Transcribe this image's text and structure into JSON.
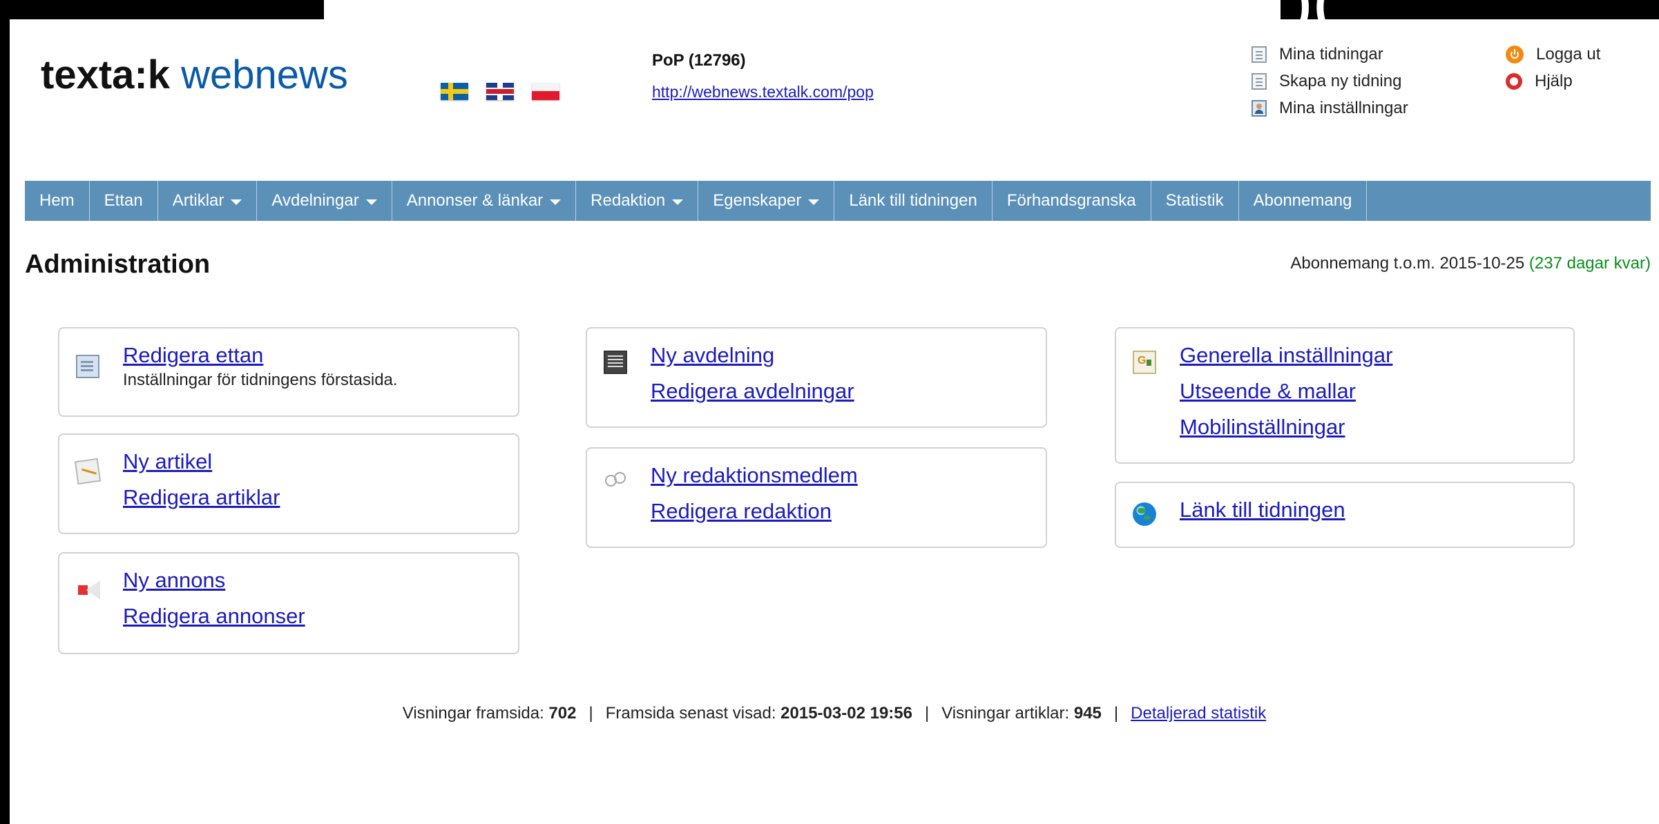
{
  "brand": {
    "logo_bold": "texta:k",
    "logo_light": " webnews"
  },
  "account": {
    "title": "PoP (12796)",
    "url": "http://webnews.textalk.com/pop"
  },
  "top_links": {
    "column_one": [
      {
        "label": "Mina tidningar",
        "icon": "document-icon"
      },
      {
        "label": "Skapa ny tidning",
        "icon": "document-icon"
      },
      {
        "label": "Mina inställningar",
        "icon": "user-settings-icon"
      }
    ],
    "column_two": [
      {
        "label": "Logga ut",
        "icon": "power-icon"
      },
      {
        "label": "Hjälp",
        "icon": "help-icon"
      }
    ]
  },
  "nav": {
    "items": [
      {
        "label": "Hem",
        "dropdown": false
      },
      {
        "label": "Ettan",
        "dropdown": false
      },
      {
        "label": "Artiklar",
        "dropdown": true
      },
      {
        "label": "Avdelningar",
        "dropdown": true
      },
      {
        "label": "Annonser & länkar",
        "dropdown": true
      },
      {
        "label": "Redaktion",
        "dropdown": true
      },
      {
        "label": "Egenskaper",
        "dropdown": true
      },
      {
        "label": "Länk till tidningen",
        "dropdown": false
      },
      {
        "label": "Förhandsgranska",
        "dropdown": false
      },
      {
        "label": "Statistik",
        "dropdown": false
      },
      {
        "label": "Abonnemang",
        "dropdown": false
      }
    ]
  },
  "main": {
    "title": "Administration",
    "subscription": {
      "prefix": "Abonnemang t.o.m. 2015-10-25 ",
      "remaining": "(237 dagar kvar)"
    },
    "cards": {
      "ettan": {
        "link": "Redigera ettan",
        "description": "Inställningar för tidningens förstasida."
      },
      "artikel": {
        "primary": "Ny artikel",
        "secondary": "Redigera artiklar"
      },
      "annons": {
        "primary": "Ny annons",
        "secondary": "Redigera annonser"
      },
      "avdelning": {
        "primary": "Ny avdelning",
        "secondary": "Redigera avdelningar"
      },
      "redaktion": {
        "primary": "Ny redaktionsmedlem",
        "secondary": "Redigera redaktion"
      },
      "installningar": {
        "primary": "Generella inställningar",
        "secondary": "Utseende & mallar",
        "tertiary": "Mobilinställningar"
      },
      "lank": {
        "primary": "Länk till tidningen"
      }
    }
  },
  "stats": {
    "front_label": "Visningar framsida:",
    "front_value": "702",
    "last_label": "Framsida senast visad:",
    "last_value": "2015-03-02 19:56",
    "articles_label": "Visningar artiklar:",
    "articles_value": "945",
    "details_link": "Detaljerad statistik",
    "separator": "|"
  },
  "colors": {
    "nav_bg": "#5b90b8",
    "link": "#1b1bbd",
    "remaining": "#079018"
  }
}
